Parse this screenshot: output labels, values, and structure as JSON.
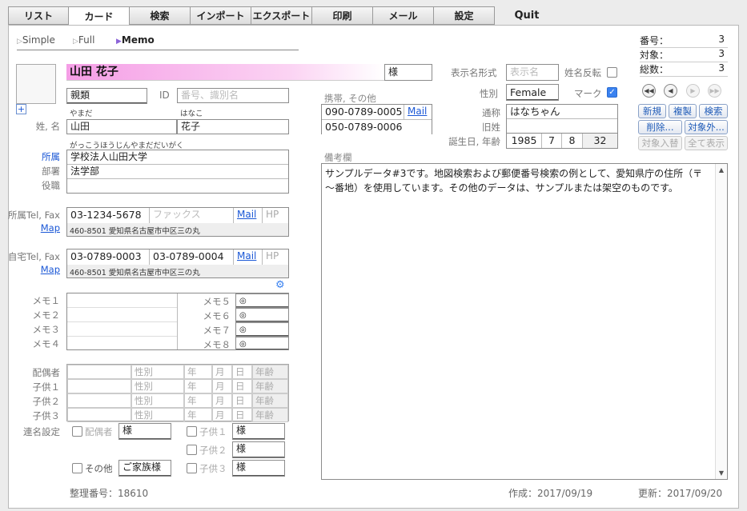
{
  "tabs": [
    "リスト",
    "カード",
    "検索",
    "インポート",
    "エクスポート",
    "印刷",
    "メール",
    "設定",
    "Quit"
  ],
  "views": [
    "Simple",
    "Full",
    "Memo"
  ],
  "stats": {
    "num_label": "番号：",
    "num": "3",
    "target_label": "対象：",
    "target": "3",
    "total_label": "総数：",
    "total": "3"
  },
  "name": {
    "full": "山田 花子",
    "honorific": "様",
    "relation": "親類",
    "id_label": "ID",
    "id_placeholder": "番号、識別名",
    "last_kana": "やまだ",
    "first_kana": "はなこ",
    "name_label": "姓, 名",
    "last": "山田",
    "first": "花子"
  },
  "org": {
    "kana": "がっこうほうじんやまだだいがく",
    "affil_label": "所属",
    "affil": "学校法人山田大学",
    "dept_label": "部署",
    "dept": "法学部",
    "title_label": "役職"
  },
  "work": {
    "label": "所属Tel, Fax",
    "tel": "03-1234-5678",
    "fax_placeholder": "ファックス",
    "mail": "Mail",
    "hp": "HP",
    "map": "Map",
    "address": "460-8501 愛知県名古屋市中区三の丸"
  },
  "home": {
    "label": "自宅Tel, Fax",
    "tel": "03-0789-0003",
    "fax": "03-0789-0004",
    "mail": "Mail",
    "hp": "HP",
    "map": "Map",
    "address": "460-8501 愛知県名古屋市中区三の丸"
  },
  "memo": {
    "l1": "メモ１",
    "l2": "メモ２",
    "l3": "メモ３",
    "l4": "メモ４",
    "l5": "メモ５",
    "l6": "メモ６",
    "l7": "メモ７",
    "l8": "メモ８",
    "mark": "◎"
  },
  "family": {
    "spouse": "配偶者",
    "child1": "子供１",
    "child2": "子供２",
    "child3": "子供３",
    "gender": "性別",
    "year": "年",
    "month": "月",
    "day": "日",
    "age": "年齢"
  },
  "joint": {
    "label": "連名設定",
    "spouse": "配偶者",
    "spouse_val": "様",
    "other": "その他",
    "other_val": "ご家族様",
    "c1": "子供１",
    "c1_val": "様",
    "c2": "子供２",
    "c2_val": "様",
    "c3": "子供３",
    "c3_val": "様"
  },
  "mobile": {
    "label": "携帯, その他",
    "m1": "090-0789-0005",
    "mail": "Mail",
    "m2": "050-0789-0006"
  },
  "display": {
    "format_label": "表示名形式",
    "format_placeholder": "表示名",
    "reverse_label": "姓名反転",
    "gender_label": "性別",
    "gender": "Female",
    "mark_label": "マーク",
    "nick_label": "通称",
    "nick": "はなちゃん",
    "old_label": "旧姓",
    "birth_label": "誕生日, 年齢",
    "year": "1985",
    "month": "7",
    "day": "8",
    "age": "32"
  },
  "buttons": {
    "new": "新規",
    "copy": "複製",
    "search": "検索",
    "delete": "削除...",
    "exclude": "対象外...",
    "swap": "対象入替",
    "showall": "全て表示"
  },
  "notes": {
    "label": "備考欄",
    "text": "サンプルデータ#3です。地図検索および郵便番号検索の例として、愛知県庁の住所（〒～番地）を使用しています。その他のデータは、サンプルまたは架空のものです。"
  },
  "footer": {
    "serial": "整理番号：18610",
    "created": "作成：2017/09/19",
    "updated": "更新：2017/09/20"
  }
}
